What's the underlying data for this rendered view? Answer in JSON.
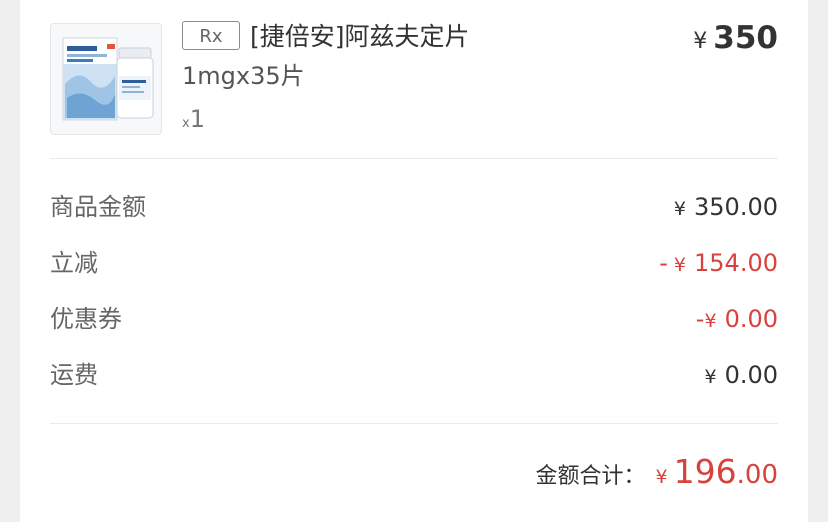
{
  "product": {
    "rx_tag": "Rx",
    "name": "[捷倍安]阿兹夫定片",
    "spec": "1mgx35片",
    "qty_prefix": "x",
    "qty": "1",
    "price_currency": "¥",
    "price": "350"
  },
  "summary": [
    {
      "label": "商品金额",
      "sign": "",
      "currency": "¥",
      "amount": "350.00",
      "emphasis": false
    },
    {
      "label": "立减",
      "sign": "-",
      "currency": "¥",
      "amount": "154.00",
      "emphasis": true
    },
    {
      "label": "优惠券",
      "sign": "-",
      "currency": "¥",
      "amount": "0.00",
      "emphasis": true
    },
    {
      "label": "运费",
      "sign": "",
      "currency": "¥",
      "amount": "0.00",
      "emphasis": false
    }
  ],
  "total": {
    "label": "金额合计：",
    "currency": "¥",
    "integer": "196",
    "decimal": ".00"
  },
  "colors": {
    "accent_red": "#d9413c",
    "text": "#333333",
    "muted": "#666666"
  }
}
